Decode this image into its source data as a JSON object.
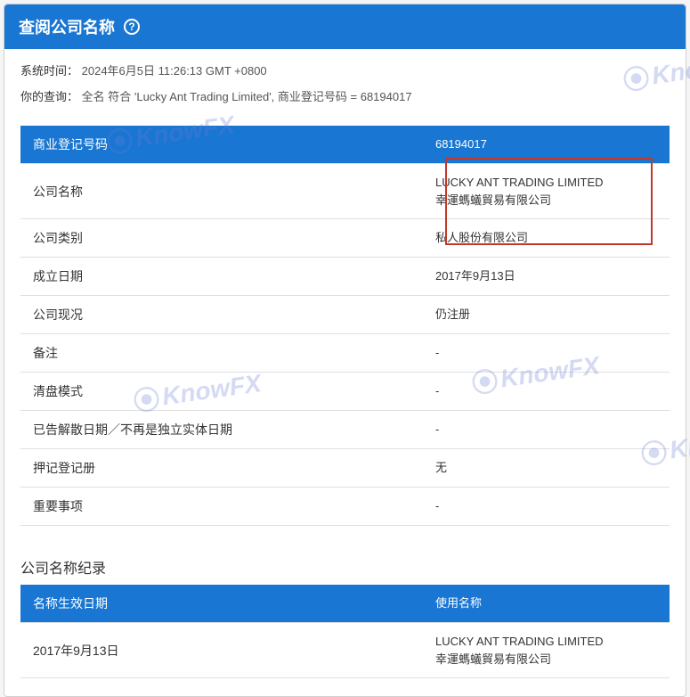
{
  "header": {
    "title": "查阅公司名称",
    "help_symbol": "?"
  },
  "meta": {
    "system_time_label": "系统时间：",
    "system_time_value": "2024年6月5日 11:26:13 GMT +0800",
    "query_label": "你的查询：",
    "query_value": "全名 符合 'Lucky Ant Trading Limited', 商业登记号码 = 68194017"
  },
  "main_table": {
    "rows": [
      {
        "label": "商业登记号码",
        "value": "68194017",
        "header": true
      },
      {
        "label": "公司名称",
        "value": "LUCKY ANT TRADING LIMITED\n幸運螞蟻貿易有限公司"
      },
      {
        "label": "公司类别",
        "value": "私人股份有限公司"
      },
      {
        "label": "成立日期",
        "value": "2017年9月13日"
      },
      {
        "label": "公司现况",
        "value": "仍注册"
      },
      {
        "label": "备注",
        "value": "-"
      },
      {
        "label": "清盘模式",
        "value": "-"
      },
      {
        "label": "已告解散日期／不再是独立实体日期",
        "value": "-"
      },
      {
        "label": "押记登记册",
        "value": "无"
      },
      {
        "label": "重要事项",
        "value": "-"
      }
    ]
  },
  "name_history": {
    "title": "公司名称纪录",
    "rows": [
      {
        "label": "名称生效日期",
        "value": "使用名称",
        "header": true
      },
      {
        "label": "2017年9月13日",
        "value": "LUCKY ANT TRADING LIMITED\n幸運螞蟻貿易有限公司"
      }
    ]
  },
  "watermark": "KnowFX"
}
